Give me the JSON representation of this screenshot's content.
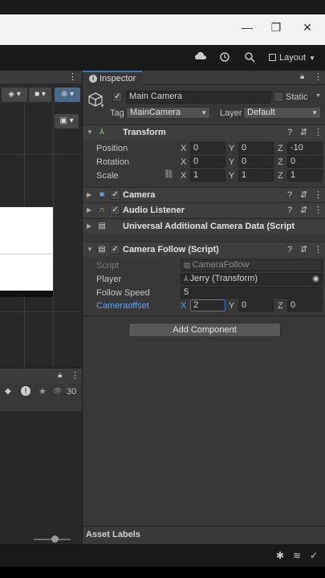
{
  "window": {
    "controls": [
      {
        "name": "minimize-icon",
        "glyph": "—"
      },
      {
        "name": "restore-icon",
        "glyph": "❐"
      },
      {
        "name": "close-icon",
        "glyph": "✕"
      }
    ]
  },
  "toolbar": {
    "layout_label": "Layout"
  },
  "hierarchy": {
    "visible_count": "30"
  },
  "inspector": {
    "tab_label": "Inspector",
    "object_name": "Main Camera",
    "static_label": "Static",
    "tag_label": "Tag",
    "tag_value": "MainCamera",
    "layer_label": "Layer",
    "layer_value": "Default",
    "transform": {
      "title": "Transform",
      "rows": [
        {
          "label": "Position",
          "x": "0",
          "y": "0",
          "z": "-10"
        },
        {
          "label": "Rotation",
          "x": "0",
          "y": "0",
          "z": "0"
        },
        {
          "label": "Scale",
          "x": "1",
          "y": "1",
          "z": "1"
        }
      ]
    },
    "components": [
      {
        "title": "Camera"
      },
      {
        "title": "Audio Listener"
      },
      {
        "title": "Universal Additional Camera Data (Script"
      }
    ],
    "camera_follow": {
      "title": "Camera Follow (Script)",
      "script_label": "Script",
      "script_value": "CameraFollow",
      "player_label": "Player",
      "player_value": "Jerry (Transform)",
      "follow_speed_label": "Follow Speed",
      "follow_speed_value": "5",
      "offset_label": "Cameraoffset",
      "offset_x": "2",
      "offset_y": "0",
      "offset_z": "0"
    },
    "add_component_label": "Add Component",
    "asset_labels": "Asset Labels"
  },
  "axes": {
    "x": "X",
    "y": "Y",
    "z": "Z"
  },
  "colors": {
    "accent": "#3a79bb",
    "label_blue": "#5ea3f0",
    "panel": "#383838"
  }
}
